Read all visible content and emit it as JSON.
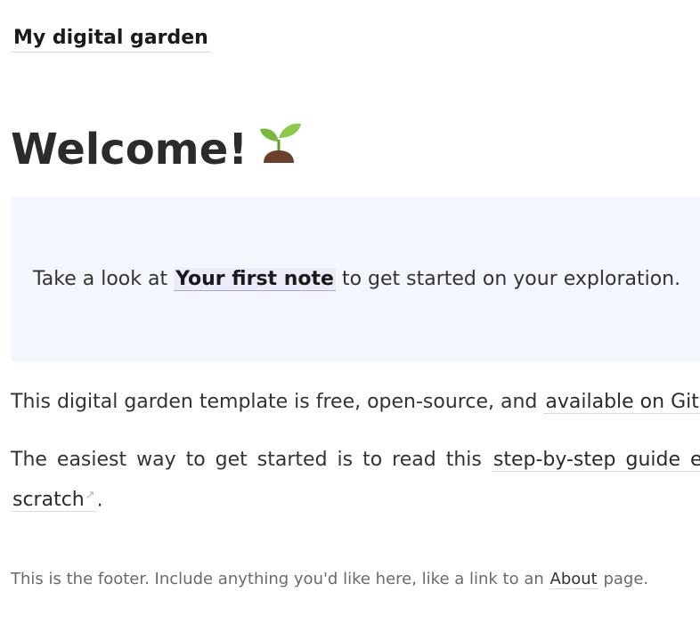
{
  "header": {
    "site_title": "My digital garden"
  },
  "main": {
    "heading": "Welcome!",
    "heading_icon": "seedling-icon",
    "callout": {
      "before": "Take a look at ",
      "link_label": "Your first note",
      "after": " to get started on your exploration."
    },
    "paragraph1": {
      "before": "This digital garden template is free, open-source, and ",
      "link_label": "available on GitHub"
    },
    "paragraph2": {
      "before": "The easiest way to get started is to read this ",
      "link_label_line1": "step-by-step guide expla",
      "link_label_line2": "scratch",
      "link_icon": "external-link-icon",
      "after": "."
    }
  },
  "footer": {
    "before": "This is the footer. Include anything you'd like here, like a link to an ",
    "link_label": "About",
    "after": " page."
  },
  "colors": {
    "callout_background": "#f4f6fe",
    "internal_link_background": "#ecebfa",
    "text": "#333333"
  }
}
